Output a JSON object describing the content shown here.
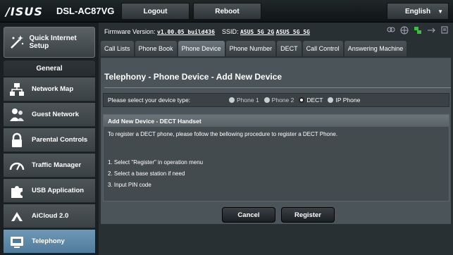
{
  "header": {
    "brand": "/ISUS",
    "model": "DSL-AC87VG",
    "logout_label": "Logout",
    "reboot_label": "Reboot",
    "language": "English"
  },
  "sidebar": {
    "qis_label": "Quick Internet Setup",
    "general_label": "General",
    "items": [
      {
        "label": "Network Map",
        "icon": "network-map-icon"
      },
      {
        "label": "Guest Network",
        "icon": "guest-network-icon"
      },
      {
        "label": "Parental Controls",
        "icon": "lock-icon"
      },
      {
        "label": "Traffic Manager",
        "icon": "gauge-icon"
      },
      {
        "label": "USB Application",
        "icon": "puzzle-icon"
      },
      {
        "label": "AiCloud 2.0",
        "icon": "cloud-icon"
      },
      {
        "label": "Telephony",
        "icon": "telephone-icon"
      }
    ]
  },
  "status": {
    "firmware_label": "Firmware Version:",
    "firmware_value": "v1.00.05_build436",
    "ssid_label": "SSID:",
    "ssid_1": "ASUS_5G_2G",
    "ssid_2": "ASUS_5G_5G"
  },
  "tabs": [
    {
      "label": "Call Lists"
    },
    {
      "label": "Phone Book"
    },
    {
      "label": "Phone Device",
      "active": true
    },
    {
      "label": "Phone Number"
    },
    {
      "label": "DECT"
    },
    {
      "label": "Call Control"
    },
    {
      "label": "Answering Machine"
    }
  ],
  "page": {
    "title": "Telephony - Phone Device - Add New Device",
    "device_type_label": "Please select your device type:",
    "device_options": [
      {
        "label": "Phone 1",
        "selected": false
      },
      {
        "label": "Phone 2",
        "selected": false
      },
      {
        "label": "DECT",
        "selected": true
      },
      {
        "label": "IP Phone",
        "selected": false
      }
    ],
    "section_title": "Add New Device - DECT Handset",
    "intro": "To register a DECT phone, please follow the bellowing procedure to register a DECT Phone.",
    "steps": [
      "1. Select \"Register\" in operation menu",
      "2. Select a base station if need",
      "3. Input PIN code"
    ],
    "cancel_label": "Cancel",
    "register_label": "Register"
  }
}
